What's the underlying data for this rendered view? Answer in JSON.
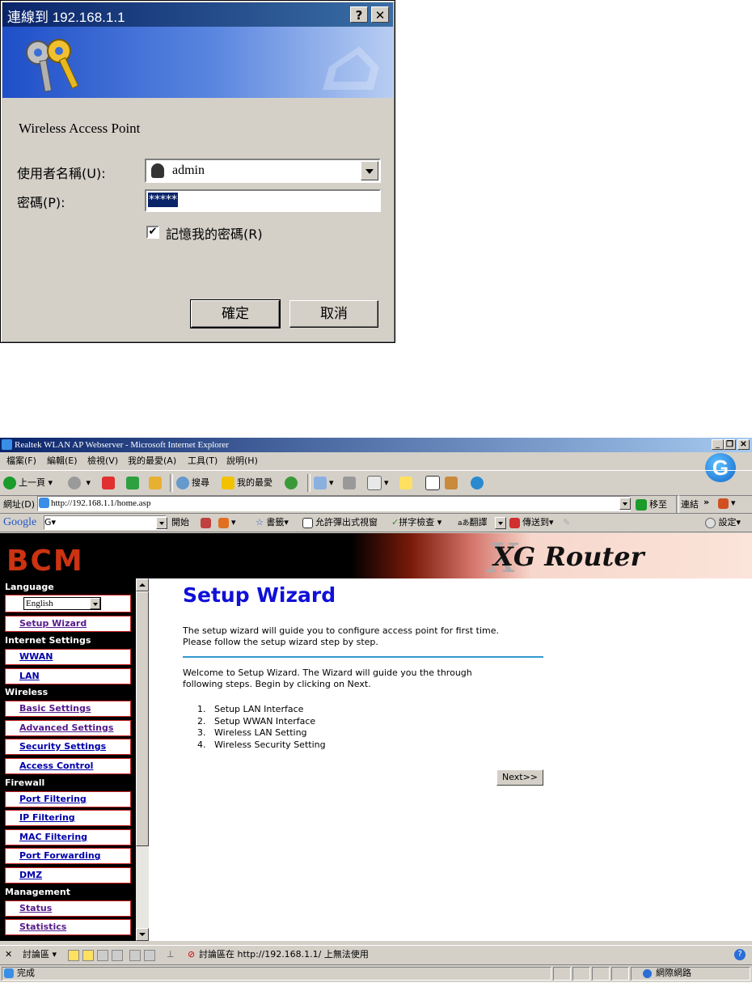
{
  "login_dialog": {
    "title": "連線到 192.168.1.1",
    "help_glyph": "?",
    "close_glyph": "✕",
    "realm": "Wireless Access Point",
    "username_label": "使用者名稱(U):",
    "username_value": "admin",
    "password_label": "密碼(P):",
    "password_value": "*****",
    "remember_label": "記憶我的密碼(R)",
    "remember_checked": true,
    "ok_label": "確定",
    "cancel_label": "取消"
  },
  "browser": {
    "title": "Realtek WLAN AP Webserver - Microsoft Internet Explorer",
    "menu": [
      "檔案(F)",
      "編輯(E)",
      "檢視(V)",
      "我的最愛(A)",
      "工具(T)",
      "說明(H)"
    ],
    "toolbar": {
      "back": "上一頁",
      "search": "搜尋",
      "favorites": "我的最愛"
    },
    "address_label": "網址(D)",
    "address_value": "http://192.168.1.1/home.asp",
    "go_label": "移至",
    "links_label": "連結",
    "google_bar": {
      "logo": "Google",
      "search_value": "G▾",
      "start": "開始",
      "bookmarks": "書籤▾",
      "popups": "允許彈出式視窗",
      "spellcheck": "拼字檢查 ▾",
      "translate": "翻譯",
      "sendto": "傳送到▾",
      "settings": "設定▾"
    },
    "discussion_bar": {
      "label": "討論區 ▾",
      "message": "討論區在 http://192.168.1.1/ 上無法使用"
    },
    "status": {
      "text": "完成",
      "zone": "網際網路"
    }
  },
  "page": {
    "logo": "BCM",
    "product": "XG Router",
    "nav": {
      "language_heading": "Language",
      "language_value": "English",
      "setup_wizard": "Setup Wizard",
      "internet_heading": "Internet Settings",
      "wwan": "WWAN",
      "lan": "LAN",
      "wireless_heading": "Wireless",
      "basic": "Basic Settings",
      "advanced": "Advanced Settings",
      "security": "Security Settings",
      "access": "Access Control",
      "firewall_heading": "Firewall",
      "port_filtering": "Port Filtering",
      "ip_filtering": "IP Filtering",
      "mac_filtering": "MAC Filtering",
      "port_forwarding": "Port Forwarding",
      "dmz": "DMZ",
      "management_heading": "Management",
      "status": "Status",
      "statistics": "Statistics"
    },
    "title": "Setup Wizard",
    "intro_line1": "The setup wizard will guide you to configure access point for first time.",
    "intro_line2": "Please follow the setup wizard step by step.",
    "welcome_line1": "Welcome to Setup Wizard. The Wizard will guide you the through",
    "welcome_line2": "following steps. Begin by clicking on Next.",
    "steps": [
      "Setup LAN Interface",
      "Setup WWAN Interface",
      "Wireless LAN Setting",
      "Wireless Security Setting"
    ],
    "next_label": "Next>>"
  }
}
